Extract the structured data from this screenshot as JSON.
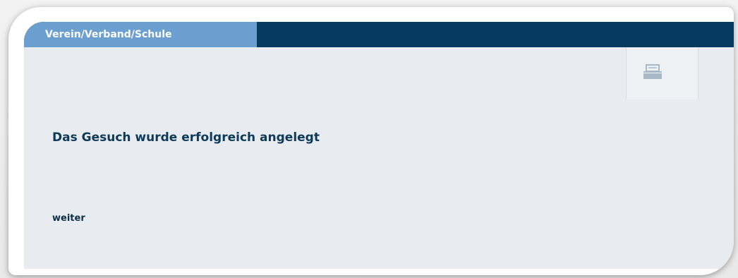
{
  "tabs": [
    {
      "label": "Verein/Verband/Schule",
      "active": true
    }
  ],
  "toolbar": {
    "print_icon": "printer-icon"
  },
  "main": {
    "message": "Das Gesuch wurde erfolgreich angelegt",
    "continue_link": "weiter"
  },
  "colors": {
    "tabbar_dark": "#043b5e",
    "tab_active": "#6b9fd0",
    "panel_bg": "#e8ecf0",
    "text_primary": "#0e3a5a"
  }
}
